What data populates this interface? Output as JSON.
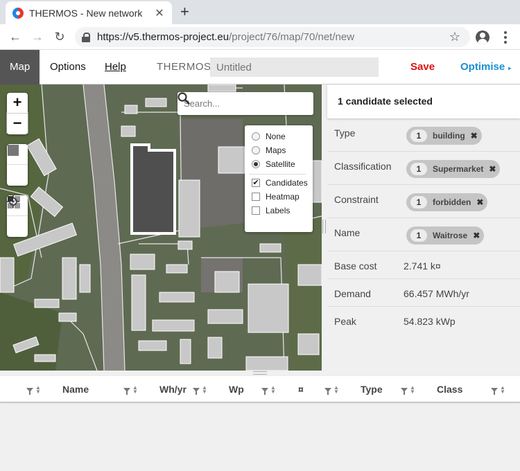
{
  "browser": {
    "tab_title": "THERMOS - New network",
    "url_host": "https://v5.thermos-project.eu",
    "url_path": "/project/76/map/70/net/new"
  },
  "nav": {
    "map_label": "Map",
    "options_label": "Options",
    "help_label": "Help",
    "brand": "THERMOS",
    "title_placeholder": "Untitled",
    "save_label": "Save",
    "optimise_label": "Optimise"
  },
  "map": {
    "search_placeholder": "Search...",
    "layers": {
      "base": [
        "None",
        "Maps",
        "Satellite"
      ],
      "base_selected": "Satellite",
      "overlays": [
        {
          "label": "Candidates",
          "checked": true
        },
        {
          "label": "Heatmap",
          "checked": false
        },
        {
          "label": "Labels",
          "checked": false
        }
      ]
    }
  },
  "panel": {
    "header": "1 candidate selected",
    "chips": [
      {
        "label": "Type",
        "count": "1",
        "value": "building"
      },
      {
        "label": "Classification",
        "count": "1",
        "value": "Supermarket"
      },
      {
        "label": "Constraint",
        "count": "1",
        "value": "forbidden"
      },
      {
        "label": "Name",
        "count": "1",
        "value": "Waitrose"
      }
    ],
    "stats": [
      {
        "label": "Base cost",
        "value": "2.741 k¤"
      },
      {
        "label": "Demand",
        "value": "66.457 MWh/yr"
      },
      {
        "label": "Peak",
        "value": "54.823 kWp"
      }
    ]
  },
  "table": {
    "columns": [
      "Name",
      "Wh/yr",
      "Wp",
      "¤",
      "Type",
      "Class"
    ]
  }
}
